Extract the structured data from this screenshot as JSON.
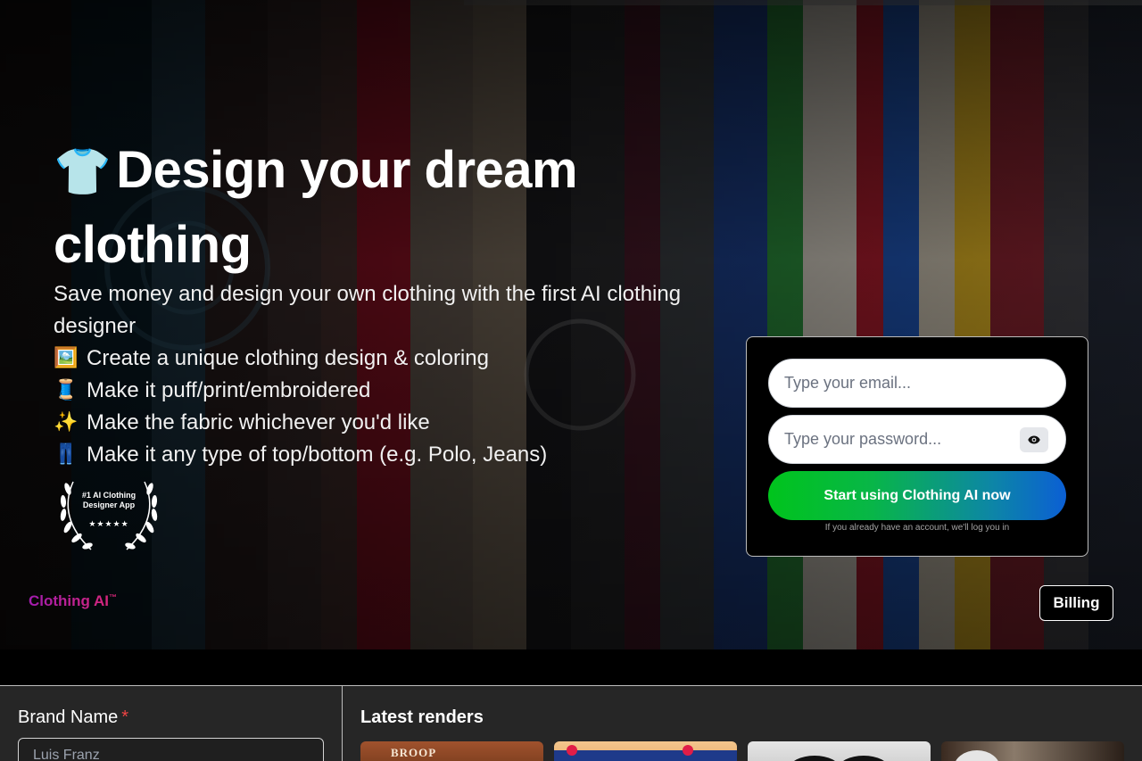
{
  "hero": {
    "emoji": "👕",
    "title": "Design your dream clothing",
    "subtitle": "Save money and design your own clothing with the first AI clothing designer",
    "features": [
      {
        "emoji": "🖼️",
        "text": "Create a unique clothing design & coloring"
      },
      {
        "emoji": "🧵",
        "text": "Make it puff/print/embroidered"
      },
      {
        "emoji": "✨",
        "text": "Make the fabric whichever you'd like"
      },
      {
        "emoji": "👖",
        "text": "Make it any type of top/bottom (e.g. Polo, Jeans)"
      }
    ],
    "award": {
      "line1": "#1 AI Clothing",
      "line2": "Designer App",
      "stars": "★★★★★"
    }
  },
  "brand": {
    "name": "Clothing AI",
    "tm": "™"
  },
  "nav": {
    "billing_label": "Billing"
  },
  "login": {
    "email_placeholder": "Type your email...",
    "password_placeholder": "Type your password...",
    "cta_label": "Start using Clothing AI now",
    "hint": "If you already have an account, we'll log you in"
  },
  "form": {
    "brand_label": "Brand Name",
    "required_mark": "*",
    "brand_value": "Luis Franz"
  },
  "renders": {
    "title": "Latest renders",
    "thumb1_text": "BROOP"
  },
  "colors": {
    "cta_start": "#00c41c",
    "cta_end": "#0b5fd4",
    "brand_gradient_start": "#a21caf",
    "brand_gradient_end": "#db2777",
    "required": "#ef4444"
  }
}
